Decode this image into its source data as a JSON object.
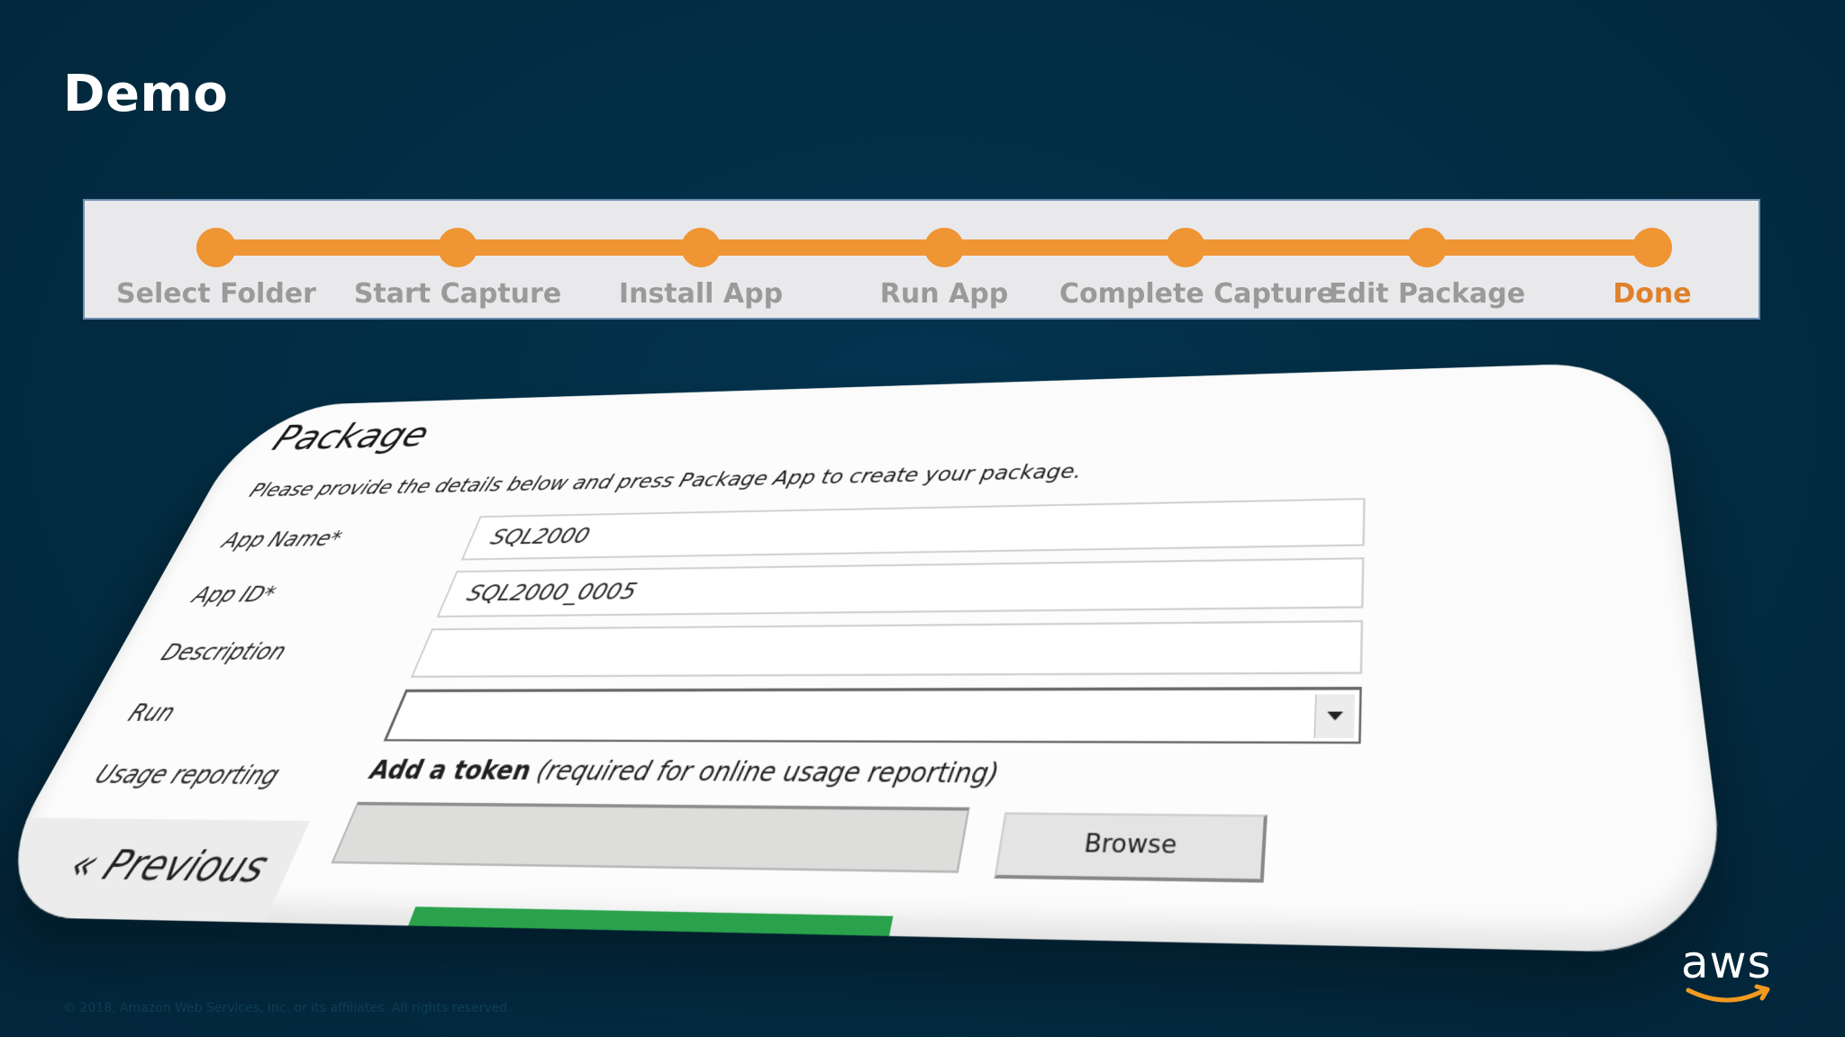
{
  "slide": {
    "title": "Demo",
    "footer": "© 2018, Amazon Web Services, Inc. or its affiliates. All rights reserved."
  },
  "stepper": {
    "steps": [
      {
        "label": "Select Folder"
      },
      {
        "label": "Start Capture"
      },
      {
        "label": "Install App"
      },
      {
        "label": "Run App"
      },
      {
        "label": "Complete Capture"
      },
      {
        "label": "Edit Package"
      },
      {
        "label": "Done"
      }
    ],
    "active_step": "Done",
    "accent_color": "#ef9534"
  },
  "package_form": {
    "title": "Package",
    "description": "Please provide the details below and press Package App to create your package.",
    "fields": {
      "app_name": {
        "label": "App Name*",
        "value": "SQL2000"
      },
      "app_id": {
        "label": "App ID*",
        "value": "SQL2000_0005"
      },
      "description": {
        "label": "Description",
        "value": ""
      },
      "run": {
        "label": "Run",
        "value": ""
      },
      "usage_reporting": {
        "label": "Usage reporting"
      }
    },
    "token": {
      "label_bold": "Add a token",
      "label_note": "(required for online usage reporting)",
      "value": ""
    },
    "browse_label": "Browse",
    "previous_label": "« Previous"
  },
  "branding": {
    "logo_text": "aws"
  }
}
